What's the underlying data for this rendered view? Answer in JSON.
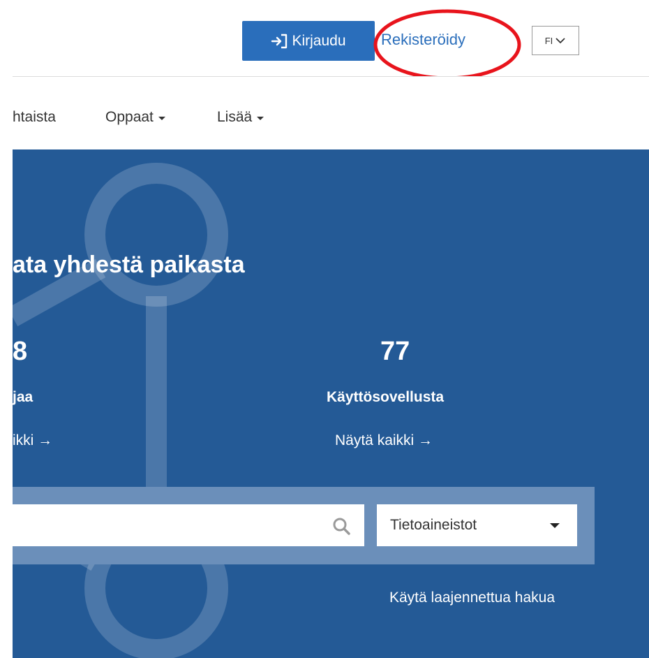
{
  "header": {
    "login_label": "Kirjaudu",
    "register_label": "Rekisteröidy",
    "language": "FI"
  },
  "nav": {
    "items": [
      {
        "label": "htaista"
      },
      {
        "label": "Oppaat"
      },
      {
        "label": "Lisää"
      }
    ]
  },
  "hero": {
    "title": "ata yhdestä paikasta",
    "stats": [
      {
        "number": "8",
        "label": "jaa",
        "link": "ikki →"
      },
      {
        "number": "77",
        "label": "Käyttösovellusta",
        "link": "Näytä kaikki →"
      }
    ],
    "search": {
      "value": "",
      "type_selected": "Tietoaineistot"
    },
    "advanced_search_label": "Käytä laajennettua hakua"
  },
  "colors": {
    "primary": "#2a6ebb",
    "hero_bg": "#245a96",
    "search_band": "#6b8fba",
    "annotation_red": "#e8141c"
  }
}
